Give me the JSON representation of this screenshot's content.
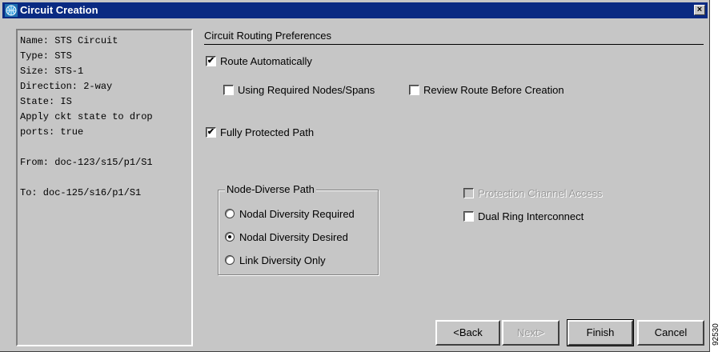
{
  "window": {
    "title": "Circuit Creation",
    "close_glyph": "×"
  },
  "summary": {
    "lines": [
      "Name: STS Circuit",
      "Type: STS",
      "Size: STS-1",
      "Direction: 2-way",
      "State: IS",
      "Apply ckt state to drop",
      "ports: true",
      "",
      "From: doc-123/s15/p1/S1",
      "",
      "To: doc-125/s16/p1/S1"
    ]
  },
  "preferences": {
    "section_title": "Circuit Routing Preferences",
    "route_automatically": {
      "label": "Route Automatically",
      "checked": true
    },
    "using_required_nodes": {
      "label": "Using Required Nodes/Spans",
      "checked": false
    },
    "review_route": {
      "label": "Review Route Before Creation",
      "checked": false
    },
    "fully_protected": {
      "label": "Fully Protected Path",
      "checked": true
    },
    "node_diverse": {
      "title": "Node-Diverse Path",
      "options": [
        {
          "label": "Nodal Diversity Required",
          "selected": false
        },
        {
          "label": "Nodal Diversity Desired",
          "selected": true
        },
        {
          "label": "Link Diversity Only",
          "selected": false
        }
      ]
    },
    "protection_channel": {
      "label": "Protection Channel Access",
      "checked": false,
      "enabled": false
    },
    "dual_ring": {
      "label": "Dual Ring Interconnect",
      "checked": false
    }
  },
  "buttons": {
    "back": "<Back",
    "next": "Next>",
    "finish": "Finish",
    "cancel": "Cancel"
  },
  "figure_id": "92530",
  "colors": {
    "titlebar": "#0a2a82",
    "dialog": "#c6c6c6",
    "disabled_text": "#9a9a9a"
  }
}
